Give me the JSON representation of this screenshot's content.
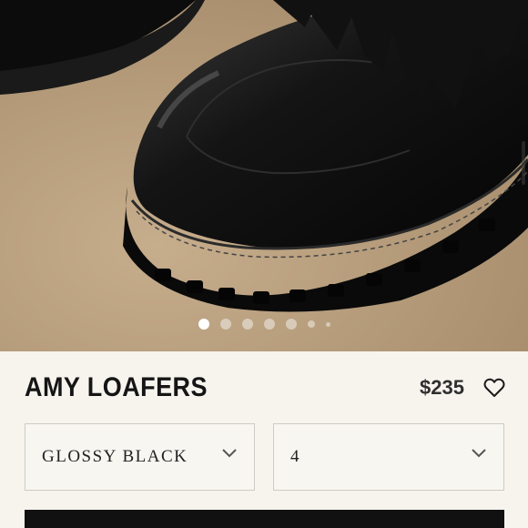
{
  "hero": {
    "image_alt": "black leather loafer with fringe on tan background",
    "carousel": {
      "total_dots": 7,
      "active_index": 0
    }
  },
  "product": {
    "title": "AMY LOAFERS",
    "price": "$235"
  },
  "options": {
    "color": {
      "selected": "GLOSSY BLACK"
    },
    "size": {
      "selected": "4"
    }
  },
  "icons": {
    "favorite": "heart-outline-icon",
    "dropdown": "chevron-down-icon"
  },
  "colors": {
    "background": "#f7f4ee",
    "hero_bg": "#b79f7f",
    "button": "#111111",
    "text": "#151515"
  }
}
